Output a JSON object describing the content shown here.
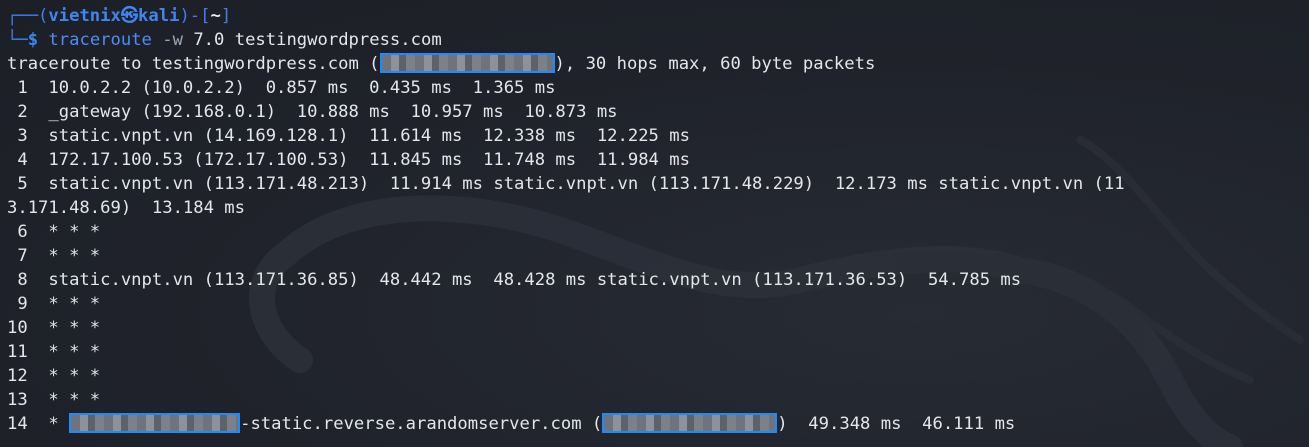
{
  "terminal": {
    "prompt": {
      "frame_top_left": "┌──(",
      "user": "vietnix",
      "skull": "㉿",
      "host": "kali",
      "frame_close": ")-[",
      "dir": "~",
      "frame_end": "]",
      "frame_bottom": "└─",
      "dollar": "$",
      "command": "traceroute",
      "flag": "-w",
      "args": "7.0 testingwordpress.com"
    },
    "header": {
      "before": "traceroute to testingwordpress.com (",
      "after": "), 30 hops max, 60 byte packets"
    },
    "hops": [
      " 1  10.0.2.2 (10.0.2.2)  0.857 ms  0.435 ms  1.365 ms",
      " 2  _gateway (192.168.0.1)  10.888 ms  10.957 ms  10.873 ms",
      " 3  static.vnpt.vn (14.169.128.1)  11.614 ms  12.338 ms  12.225 ms",
      " 4  172.17.100.53 (172.17.100.53)  11.845 ms  11.748 ms  11.984 ms",
      " 5  static.vnpt.vn (113.171.48.213)  11.914 ms static.vnpt.vn (113.171.48.229)  12.173 ms static.vnpt.vn (11",
      "3.171.48.69)  13.184 ms",
      " 6  * * *",
      " 7  * * *",
      " 8  static.vnpt.vn (113.171.36.85)  48.442 ms  48.428 ms static.vnpt.vn (113.171.36.53)  54.785 ms",
      " 9  * * *",
      "10  * * *",
      "11  * * *",
      "12  * * *",
      "13  * * *"
    ],
    "last_hop": {
      "prefix": "14  * ",
      "middle": "-static.reverse.arandomserver.com (",
      "suffix": ")  49.348 ms  46.111 ms"
    }
  },
  "colors": {
    "background": "#20232b",
    "prompt_blue": "#3f86f2",
    "redaction_border": "#1a8cff"
  }
}
